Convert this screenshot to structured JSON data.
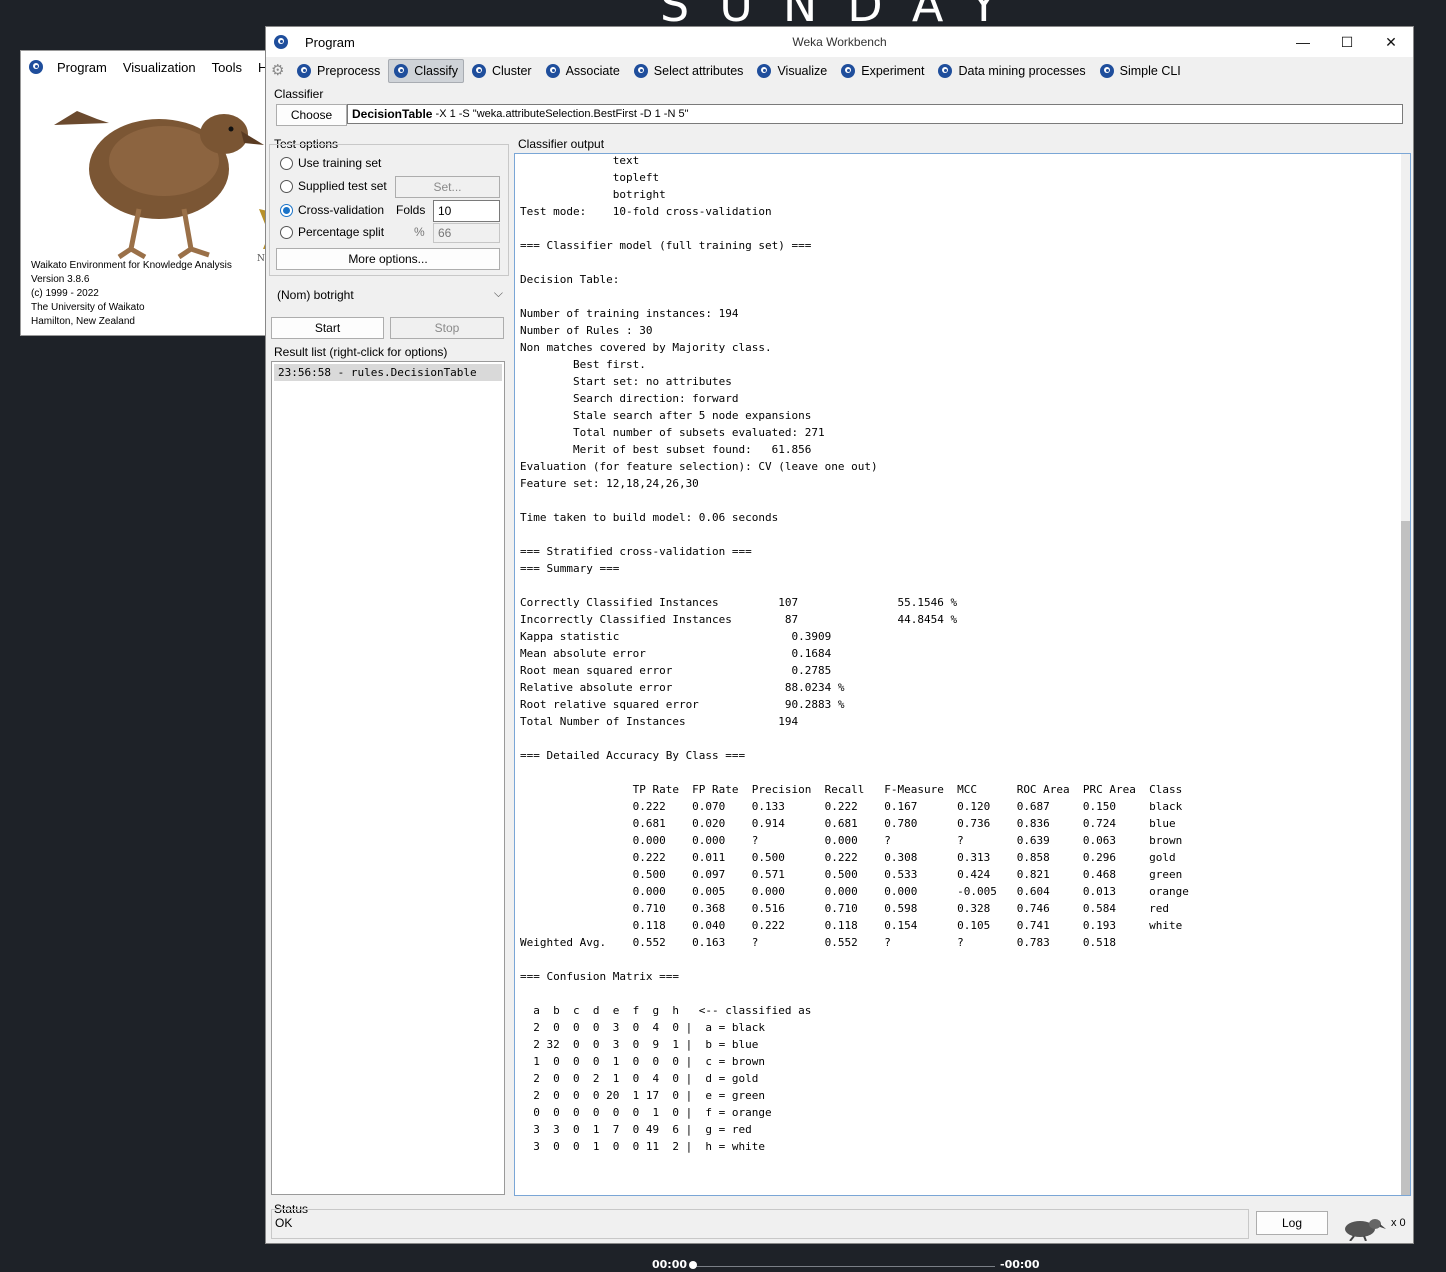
{
  "background": {
    "banner_text": "SUNDAY",
    "media_time_left": "00:00",
    "media_time_right": "-00:00"
  },
  "chooser": {
    "menu": [
      "Program",
      "Visualization",
      "Tools",
      "He"
    ],
    "info_lines": [
      "Waikato Environment for Knowledge Analysis",
      "Version 3.8.6",
      "(c) 1999 - 2022",
      "The University of Waikato",
      "Hamilton, New Zealand"
    ],
    "logo_text": "N E W"
  },
  "window": {
    "menu_program": "Program",
    "title": "Weka Workbench",
    "minimize": "—",
    "maximize": "☐",
    "close": "✕",
    "tabs": [
      "Preprocess",
      "Classify",
      "Cluster",
      "Associate",
      "Select attributes",
      "Visualize",
      "Experiment",
      "Data mining processes",
      "Simple CLI"
    ],
    "active_tab": "Classify"
  },
  "classifier": {
    "section_label": "Classifier",
    "choose_label": "Choose",
    "name": "DecisionTable",
    "options": " -X 1 -S \"weka.attributeSelection.BestFirst -D 1 -N 5\""
  },
  "test_options": {
    "section_label": "Test options",
    "use_training_set": "Use training set",
    "supplied_test_set": "Supplied test set",
    "set_button": "Set...",
    "cross_validation": "Cross-validation",
    "folds_label": "Folds",
    "folds_value": "10",
    "percentage_split": "Percentage split",
    "percent_symbol": "%",
    "percent_value": "66",
    "more_options": "More options..."
  },
  "class_attribute": "(Nom) botright",
  "run": {
    "start": "Start",
    "stop": "Stop"
  },
  "result_list": {
    "label": "Result list (right-click for options)",
    "items": [
      "23:56:58 - rules.DecisionTable"
    ]
  },
  "output": {
    "label": "Classifier output",
    "text": "              text\n              topleft\n              botright\nTest mode:    10-fold cross-validation\n\n=== Classifier model (full training set) ===\n\nDecision Table:\n\nNumber of training instances: 194\nNumber of Rules : 30\nNon matches covered by Majority class.\n        Best first.\n        Start set: no attributes\n        Search direction: forward\n        Stale search after 5 node expansions\n        Total number of subsets evaluated: 271\n        Merit of best subset found:   61.856\nEvaluation (for feature selection): CV (leave one out)\nFeature set: 12,18,24,26,30\n\nTime taken to build model: 0.06 seconds\n\n=== Stratified cross-validation ===\n=== Summary ===\n\nCorrectly Classified Instances         107               55.1546 %\nIncorrectly Classified Instances        87               44.8454 %\nKappa statistic                          0.3909\nMean absolute error                      0.1684\nRoot mean squared error                  0.2785\nRelative absolute error                 88.0234 %\nRoot relative squared error             90.2883 %\nTotal Number of Instances              194\n\n=== Detailed Accuracy By Class ===\n\n                 TP Rate  FP Rate  Precision  Recall   F-Measure  MCC      ROC Area  PRC Area  Class\n                 0.222    0.070    0.133      0.222    0.167      0.120    0.687     0.150     black\n                 0.681    0.020    0.914      0.681    0.780      0.736    0.836     0.724     blue\n                 0.000    0.000    ?          0.000    ?          ?        0.639     0.063     brown\n                 0.222    0.011    0.500      0.222    0.308      0.313    0.858     0.296     gold\n                 0.500    0.097    0.571      0.500    0.533      0.424    0.821     0.468     green\n                 0.000    0.005    0.000      0.000    0.000      -0.005   0.604     0.013     orange\n                 0.710    0.368    0.516      0.710    0.598      0.328    0.746     0.584     red\n                 0.118    0.040    0.222      0.118    0.154      0.105    0.741     0.193     white\nWeighted Avg.    0.552    0.163    ?          0.552    ?          ?        0.783     0.518\n\n=== Confusion Matrix ===\n\n  a  b  c  d  e  f  g  h   <-- classified as\n  2  0  0  0  3  0  4  0 |  a = black\n  2 32  0  0  3  0  9  1 |  b = blue\n  1  0  0  0  1  0  0  0 |  c = brown\n  2  0  0  2  1  0  4  0 |  d = gold\n  2  0  0  0 20  1 17  0 |  e = green\n  0  0  0  0  0  0  1  0 |  f = orange\n  3  3  0  1  7  0 49  6 |  g = red\n  3  0  0  1  0  0 11  2 |  h = white"
  },
  "status": {
    "label": "Status",
    "value": "OK",
    "log_button": "Log",
    "count": "x 0"
  }
}
